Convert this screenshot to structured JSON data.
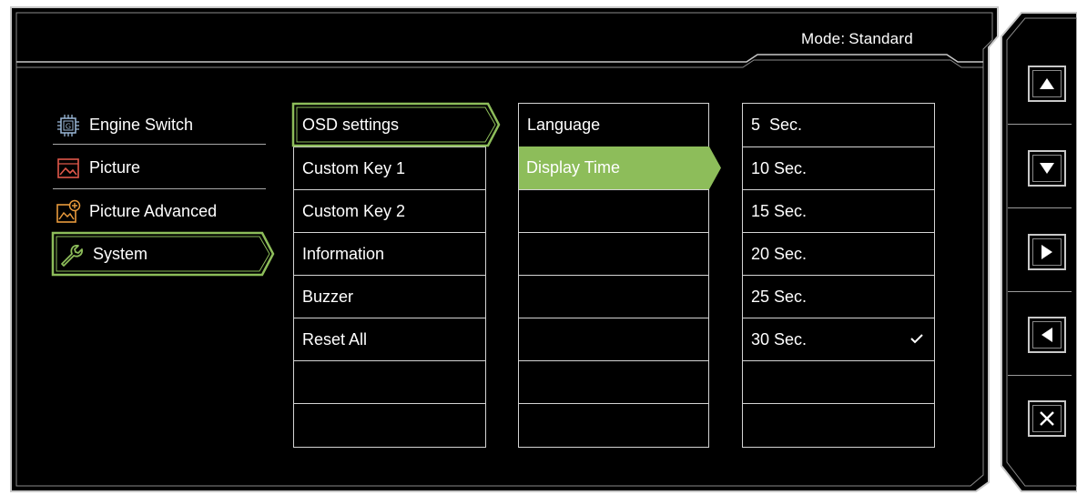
{
  "header": {
    "mode_label": "Mode:",
    "mode_value": "Standard"
  },
  "categories": [
    {
      "label": "Engine Switch",
      "icon": "engine-switch-icon",
      "selected": false
    },
    {
      "label": "Picture",
      "icon": "picture-icon",
      "selected": false
    },
    {
      "label": "Picture Advanced",
      "icon": "picture-advanced-icon",
      "selected": false
    },
    {
      "label": "System",
      "icon": "system-wrench-icon",
      "selected": true
    }
  ],
  "system_menu": {
    "items": [
      "OSD settings",
      "Custom Key 1",
      "Custom Key 2",
      "Information",
      "Buzzer",
      "Reset All",
      "",
      ""
    ],
    "selected": "OSD settings"
  },
  "osd_menu": {
    "items": [
      "Language",
      "Display Time",
      "",
      "",
      "",
      "",
      "",
      ""
    ],
    "selected": "Display Time"
  },
  "display_time_options": {
    "items": [
      "5  Sec.",
      "10 Sec.",
      "15 Sec.",
      "20 Sec.",
      "25 Sec.",
      "30 Sec.",
      "",
      ""
    ],
    "checked": "30 Sec."
  },
  "nav_buttons": [
    "up-arrow-icon",
    "down-arrow-icon",
    "right-arrow-icon",
    "left-arrow-icon",
    "close-icon"
  ],
  "colors": {
    "accent": "#8dbd5a",
    "background": "#000000",
    "frame": "#c8c8c8"
  }
}
